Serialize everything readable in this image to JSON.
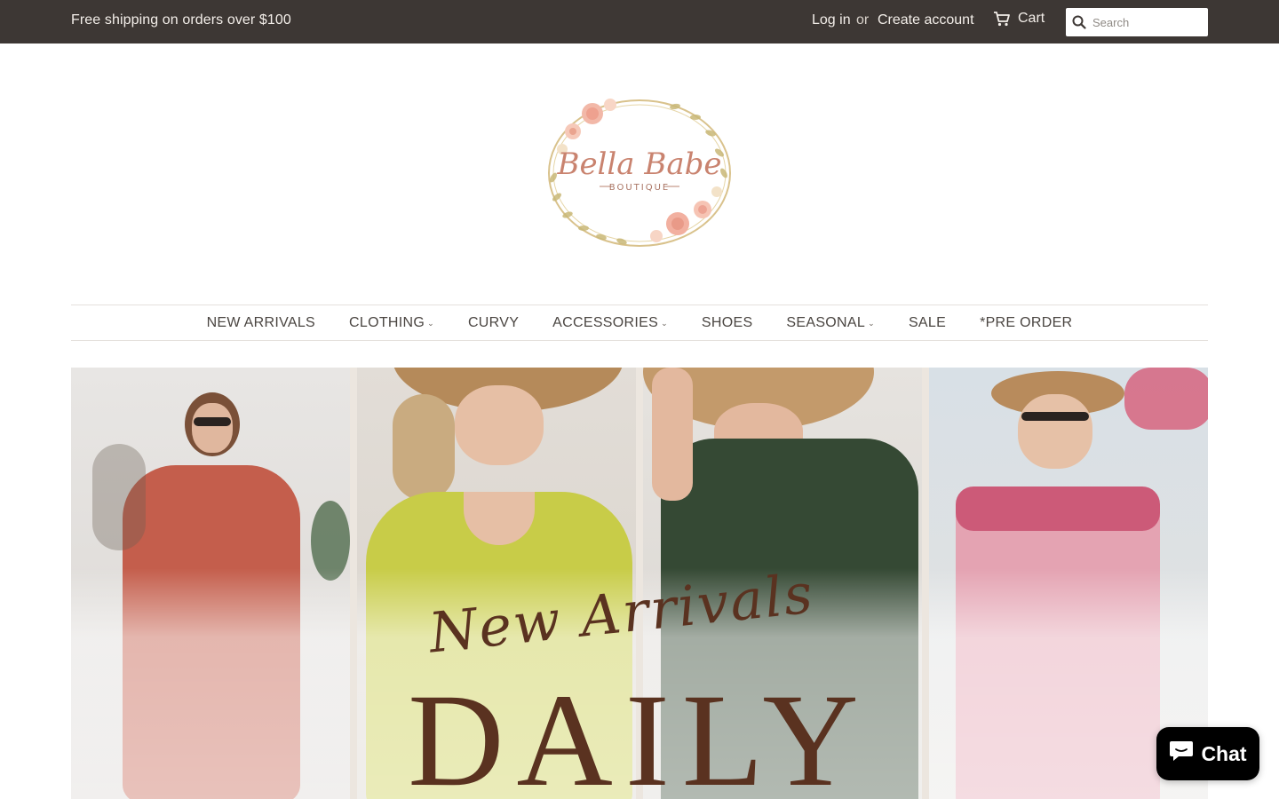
{
  "topbar": {
    "promo": "Free shipping on orders over $100",
    "login": "Log in",
    "or": "or",
    "create_account": "Create account",
    "cart": "Cart",
    "search_button": "Search",
    "search_placeholder": "Search"
  },
  "logo": {
    "brand": "Bella Babe",
    "sub": "BOUTIQUE"
  },
  "nav": {
    "items": [
      {
        "label": "NEW ARRIVALS",
        "has_dropdown": false
      },
      {
        "label": "CLOTHING",
        "has_dropdown": true
      },
      {
        "label": "CURVY",
        "has_dropdown": false
      },
      {
        "label": "ACCESSORIES",
        "has_dropdown": true
      },
      {
        "label": "SHOES",
        "has_dropdown": false
      },
      {
        "label": "SEASONAL",
        "has_dropdown": true
      },
      {
        "label": "SALE",
        "has_dropdown": false
      },
      {
        "label": "*PRE ORDER",
        "has_dropdown": false
      }
    ]
  },
  "hero": {
    "script_text": "New Arrivals",
    "big_text": "DAILY"
  },
  "chat": {
    "label": "Chat"
  },
  "colors": {
    "topbar_bg": "#3d3734",
    "text_brown": "#5a3220",
    "chat_bg": "#000000"
  },
  "icons": {
    "cart": "cart-icon",
    "search": "search-icon",
    "chat": "chat-bubble-icon",
    "dropdown": "chevron-down-icon"
  }
}
